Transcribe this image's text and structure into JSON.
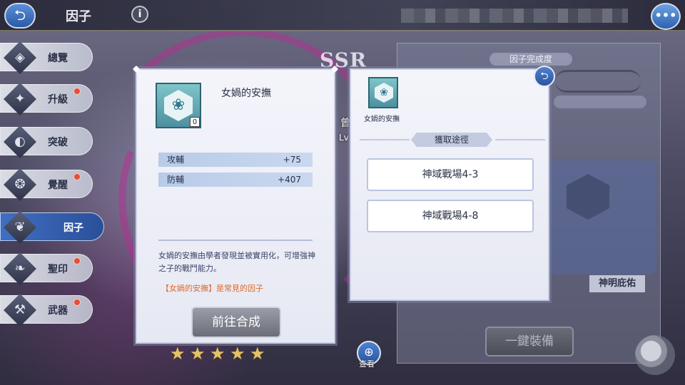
{
  "top_bar": {
    "back_icon": "back-arrow-icon",
    "title": "因子",
    "info_glyph": "i",
    "chat_icon": "chat-bubble-icon",
    "chat_glyph": "•••"
  },
  "sidebar": {
    "items": [
      {
        "label": "總覽",
        "icon": "overview-icon",
        "glyph": "◈",
        "badge": false,
        "active": false
      },
      {
        "label": "升級",
        "icon": "upgrade-icon",
        "glyph": "✦",
        "badge": true,
        "active": false
      },
      {
        "label": "突破",
        "icon": "breakthrough-icon",
        "glyph": "◐",
        "badge": false,
        "active": false
      },
      {
        "label": "覺醒",
        "icon": "awaken-icon",
        "glyph": "❂",
        "badge": true,
        "active": false
      },
      {
        "label": "因子",
        "icon": "factor-icon",
        "glyph": "❦",
        "badge": false,
        "active": true
      },
      {
        "label": "聖印",
        "icon": "seal-icon",
        "glyph": "❧",
        "badge": true,
        "active": false
      },
      {
        "label": "武器",
        "icon": "weapon-icon",
        "glyph": "⚒",
        "badge": true,
        "active": false
      }
    ]
  },
  "detail_card": {
    "factor_name": "女媧的安撫",
    "factor_icon": "lotus-icon",
    "factor_glyph": "❀",
    "owned_count": "0",
    "stats": [
      {
        "label": "攻輔",
        "value": "+75"
      },
      {
        "label": "防輔",
        "value": "+407"
      }
    ],
    "description": "女媧的安撫由學者發現並被實用化，可增強神之子的戰鬥能力。",
    "rarity_note": "【女媧的安撫】是常見的因子",
    "synthesize_label": "前往合成"
  },
  "source_card": {
    "factor_name": "女媧的安撫",
    "factor_glyph": "❀",
    "header": "獲取途徑",
    "sources": [
      "神域戰場4-3",
      "神域戰場4-8"
    ],
    "close_glyph": "⮌"
  },
  "background": {
    "rarity_badge": "SSR",
    "peek_text": "曾",
    "peek_lv": "Lv",
    "progress_label": "因子完成度",
    "blessing_label": "神明庇佑",
    "equip_all_label": "一鍵裝備",
    "view_label": "查看",
    "view_glyph": "⊕",
    "stars": 5,
    "star_glyph": "★"
  },
  "colors": {
    "accent_blue": "#2b55a0",
    "rarity_note": "#e16a2a",
    "stat_bar": "#b8cbe8",
    "badge_red": "#e0503a",
    "star_gold": "#e3c36a"
  }
}
